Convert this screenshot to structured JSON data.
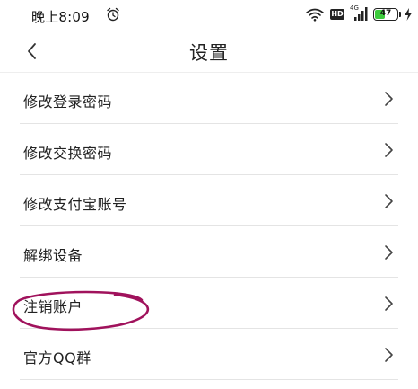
{
  "status_bar": {
    "time": "晚上8:09",
    "network_type": "4G",
    "hd_label": "HD",
    "battery_level": "47",
    "battery_fraction": 0.47,
    "icons": [
      "alarm-icon",
      "wifi-icon",
      "signal-icon",
      "battery-icon",
      "charging-icon"
    ]
  },
  "header": {
    "title": "设置",
    "back_icon": "chevron-left-icon"
  },
  "menu": {
    "items": [
      {
        "label": "修改登录密码"
      },
      {
        "label": "修改交换密码"
      },
      {
        "label": "修改支付宝账号"
      },
      {
        "label": "解绑设备"
      },
      {
        "label": "注销账户"
      },
      {
        "label": "官方QQ群"
      }
    ],
    "chevron_icon": "chevron-right-icon"
  },
  "colors": {
    "annotation": "#a0125c",
    "battery_fill": "#3ccb3c",
    "divider": "#e4e4e4",
    "text": "#222222"
  }
}
